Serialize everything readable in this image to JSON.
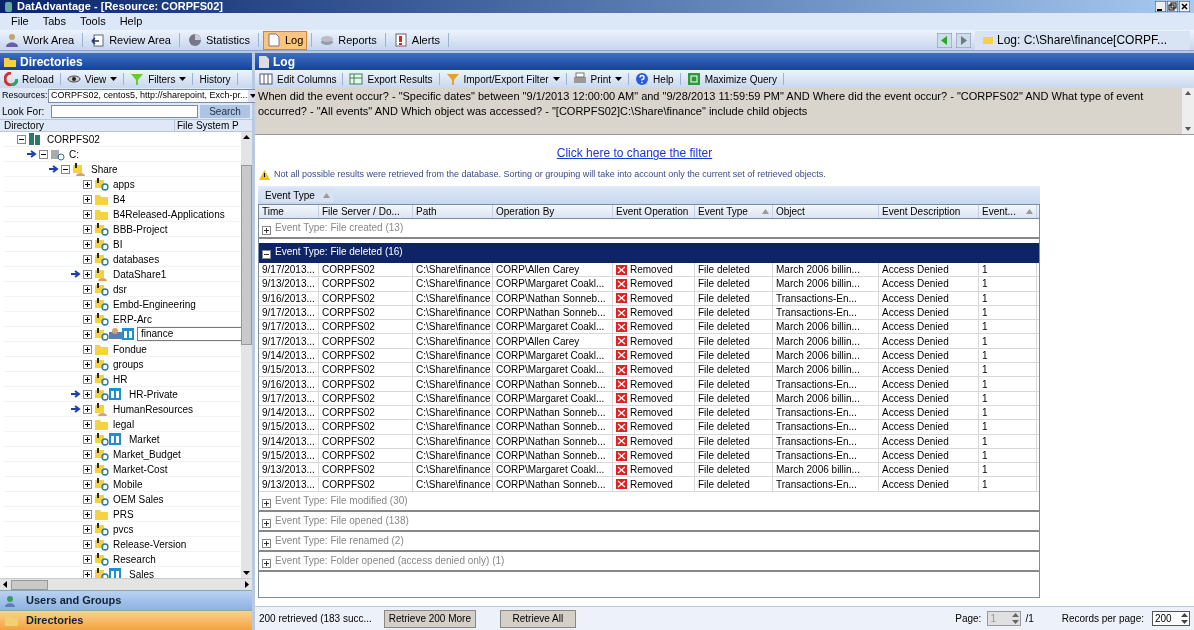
{
  "window": {
    "title": "DatAdvantage  - [Resource: CORPFS02]"
  },
  "menu": [
    "File",
    "Tabs",
    "Tools",
    "Help"
  ],
  "toolbar": [
    {
      "label": "Work Area",
      "selected": false
    },
    {
      "label": "Review Area",
      "selected": false
    },
    {
      "label": "Statistics",
      "selected": false
    },
    {
      "label": "Log",
      "selected": true
    },
    {
      "label": "Reports",
      "selected": false
    },
    {
      "label": "Alerts",
      "selected": false
    }
  ],
  "breadcrumb": "Log: C:\\Share\\finance[CORPF...",
  "left_panel": {
    "title": "Directories",
    "toolbar": [
      {
        "label": "Reload",
        "dropdown": false
      },
      {
        "label": "View",
        "dropdown": true
      },
      {
        "label": "Filters",
        "dropdown": true
      },
      {
        "label": "History",
        "dropdown": false
      }
    ],
    "resources_label": "Resources:",
    "resources_value": "CORPFS02, centos5, http://sharepoint, Exch-pr...",
    "look_for_label": "Look For:",
    "search_button": "Search",
    "columns": [
      "Directory",
      "File System P"
    ],
    "tree": [
      {
        "label": "CORPFS02",
        "kind": "server",
        "arrow": false,
        "tagged": false,
        "editing": false,
        "expanded": true,
        "children": [
          {
            "label": "C:",
            "kind": "drive",
            "arrow": true,
            "tagged": false,
            "editing": false,
            "expanded": true,
            "children": [
              {
                "label": "Share",
                "kind": "shared",
                "arrow": true,
                "tagged": false,
                "editing": false,
                "expanded": true,
                "children": [
                  {
                    "label": "apps",
                    "kind": "share",
                    "arrow": false,
                    "tagged": false,
                    "editing": false,
                    "expanded": false
                  },
                  {
                    "label": "B4",
                    "kind": "folder",
                    "arrow": false,
                    "tagged": false,
                    "editing": false,
                    "expanded": false
                  },
                  {
                    "label": "B4Released-Applications",
                    "kind": "folder",
                    "arrow": false,
                    "tagged": false,
                    "editing": false,
                    "expanded": false
                  },
                  {
                    "label": "BBB-Project",
                    "kind": "share",
                    "arrow": false,
                    "tagged": false,
                    "editing": false,
                    "expanded": false
                  },
                  {
                    "label": "BI",
                    "kind": "share",
                    "arrow": false,
                    "tagged": false,
                    "editing": false,
                    "expanded": false
                  },
                  {
                    "label": "databases",
                    "kind": "share",
                    "arrow": false,
                    "tagged": false,
                    "editing": false,
                    "expanded": false
                  },
                  {
                    "label": "DataShare1",
                    "kind": "shared",
                    "arrow": true,
                    "tagged": false,
                    "editing": false,
                    "expanded": false
                  },
                  {
                    "label": "dsr",
                    "kind": "share",
                    "arrow": false,
                    "tagged": false,
                    "editing": false,
                    "expanded": false
                  },
                  {
                    "label": "Embd-Engineering",
                    "kind": "share",
                    "arrow": false,
                    "tagged": false,
                    "editing": false,
                    "expanded": false
                  },
                  {
                    "label": "ERP-Arc",
                    "kind": "share",
                    "arrow": false,
                    "tagged": false,
                    "editing": false,
                    "expanded": false
                  },
                  {
                    "label": "finance",
                    "kind": "share",
                    "arrow": false,
                    "tagged": true,
                    "editing": true,
                    "expanded": false
                  },
                  {
                    "label": "Fondue",
                    "kind": "folder",
                    "arrow": false,
                    "tagged": false,
                    "editing": false,
                    "expanded": false
                  },
                  {
                    "label": "groups",
                    "kind": "share",
                    "arrow": false,
                    "tagged": false,
                    "editing": false,
                    "expanded": false
                  },
                  {
                    "label": "HR",
                    "kind": "share",
                    "arrow": false,
                    "tagged": false,
                    "editing": false,
                    "expanded": false
                  },
                  {
                    "label": "HR-Private",
                    "kind": "share",
                    "arrow": true,
                    "tagged": true,
                    "editing": false,
                    "expanded": false
                  },
                  {
                    "label": "HumanResources",
                    "kind": "shared",
                    "arrow": true,
                    "tagged": false,
                    "editing": false,
                    "expanded": false
                  },
                  {
                    "label": "legal",
                    "kind": "folder",
                    "arrow": false,
                    "tagged": false,
                    "editing": false,
                    "expanded": false
                  },
                  {
                    "label": "Market",
                    "kind": "share",
                    "arrow": false,
                    "tagged": true,
                    "editing": false,
                    "expanded": false
                  },
                  {
                    "label": "Market_Budget",
                    "kind": "share",
                    "arrow": false,
                    "tagged": false,
                    "editing": false,
                    "expanded": false
                  },
                  {
                    "label": "Market-Cost",
                    "kind": "share",
                    "arrow": false,
                    "tagged": false,
                    "editing": false,
                    "expanded": false
                  },
                  {
                    "label": "Mobile",
                    "kind": "share",
                    "arrow": false,
                    "tagged": false,
                    "editing": false,
                    "expanded": false
                  },
                  {
                    "label": "OEM Sales",
                    "kind": "share",
                    "arrow": false,
                    "tagged": false,
                    "editing": false,
                    "expanded": false
                  },
                  {
                    "label": "PRS",
                    "kind": "folder",
                    "arrow": false,
                    "tagged": false,
                    "editing": false,
                    "expanded": false
                  },
                  {
                    "label": "pvcs",
                    "kind": "share",
                    "arrow": false,
                    "tagged": false,
                    "editing": false,
                    "expanded": false
                  },
                  {
                    "label": "Release-Version",
                    "kind": "share",
                    "arrow": false,
                    "tagged": false,
                    "editing": false,
                    "expanded": false
                  },
                  {
                    "label": "Research",
                    "kind": "share",
                    "arrow": false,
                    "tagged": false,
                    "editing": false,
                    "expanded": false
                  },
                  {
                    "label": "Sales",
                    "kind": "share",
                    "arrow": false,
                    "tagged": true,
                    "editing": false,
                    "expanded": false
                  }
                ]
              }
            ]
          }
        ]
      }
    ],
    "nav": [
      {
        "label": "Users and Groups",
        "selected": false
      },
      {
        "label": "Directories",
        "selected": true
      }
    ]
  },
  "log_panel": {
    "title": "Log",
    "toolbar": [
      {
        "label": "Edit Columns",
        "dropdown": false
      },
      {
        "label": "Export Results",
        "dropdown": false
      },
      {
        "label": "Import/Export Filter",
        "dropdown": true
      },
      {
        "label": "Print",
        "dropdown": true
      },
      {
        "label": "Help",
        "dropdown": false
      },
      {
        "label": "Maximize Query",
        "dropdown": false
      }
    ],
    "filter_text": "When did the event occur? - \"Specific dates\" between \"9/1/2013 12:00:00 AM\" and \"9/28/2013 11:59:59 PM\" AND Where did the event occur? - \"CORPFS02\" AND What type of event occurred? - \"All events\" AND Which object was accessed? - \"[CORPFS02]C:\\Share\\finance\" include child objects",
    "change_filter_link": "Click here to change the filter",
    "warning": "Not all possible results were retrieved from the database. Sorting or grouping will take into account only the current set of retrieved objects.",
    "group_by": "Event Type",
    "columns": [
      {
        "label": "Time",
        "sorted": false
      },
      {
        "label": "File Server / Do...",
        "sorted": false
      },
      {
        "label": "Path",
        "sorted": false
      },
      {
        "label": "Operation By",
        "sorted": false
      },
      {
        "label": "Event Operation",
        "sorted": false
      },
      {
        "label": "Event Type",
        "sorted": true
      },
      {
        "label": "Object",
        "sorted": false
      },
      {
        "label": "Event Description",
        "sorted": false
      },
      {
        "label": "Event...",
        "sorted": true
      }
    ],
    "groups": [
      {
        "label": "Event Type:  File created (13)",
        "expanded": false
      },
      {
        "label": "Event Type:  File deleted (16)",
        "expanded": true,
        "rows": [
          [
            "9/17/2013...",
            "CORPFS02",
            "C:\\Share\\finance",
            "CORP\\Allen Carey",
            "Removed",
            "File deleted",
            "March  2006  billin...",
            "Access Denied",
            "1"
          ],
          [
            "9/13/2013...",
            "CORPFS02",
            "C:\\Share\\finance",
            "CORP\\Margaret  Coakl...",
            "Removed",
            "File deleted",
            "March  2006  billin...",
            "Access Denied",
            "1"
          ],
          [
            "9/16/2013...",
            "CORPFS02",
            "C:\\Share\\finance",
            "CORP\\Nathan  Sonneb...",
            "Removed",
            "File deleted",
            "Transactions-En...",
            "Access Denied",
            "1"
          ],
          [
            "9/17/2013...",
            "CORPFS02",
            "C:\\Share\\finance",
            "CORP\\Nathan  Sonneb...",
            "Removed",
            "File deleted",
            "Transactions-En...",
            "Access Denied",
            "1"
          ],
          [
            "9/17/2013...",
            "CORPFS02",
            "C:\\Share\\finance",
            "CORP\\Margaret  Coakl...",
            "Removed",
            "File deleted",
            "March  2006  billin...",
            "Access Denied",
            "1"
          ],
          [
            "9/17/2013...",
            "CORPFS02",
            "C:\\Share\\finance",
            "CORP\\Allen Carey",
            "Removed",
            "File deleted",
            "March  2006  billin...",
            "Access Denied",
            "1"
          ],
          [
            "9/14/2013...",
            "CORPFS02",
            "C:\\Share\\finance",
            "CORP\\Margaret  Coakl...",
            "Removed",
            "File deleted",
            "March  2006  billin...",
            "Access Denied",
            "1"
          ],
          [
            "9/15/2013...",
            "CORPFS02",
            "C:\\Share\\finance",
            "CORP\\Margaret  Coakl...",
            "Removed",
            "File deleted",
            "March  2006  billin...",
            "Access Denied",
            "1"
          ],
          [
            "9/16/2013...",
            "CORPFS02",
            "C:\\Share\\finance",
            "CORP\\Nathan  Sonneb...",
            "Removed",
            "File deleted",
            "Transactions-En...",
            "Access Denied",
            "1"
          ],
          [
            "9/17/2013...",
            "CORPFS02",
            "C:\\Share\\finance",
            "CORP\\Margaret  Coakl...",
            "Removed",
            "File deleted",
            "March  2006  billin...",
            "Access Denied",
            "1"
          ],
          [
            "9/14/2013...",
            "CORPFS02",
            "C:\\Share\\finance",
            "CORP\\Nathan  Sonneb...",
            "Removed",
            "File deleted",
            "Transactions-En...",
            "Access Denied",
            "1"
          ],
          [
            "9/15/2013...",
            "CORPFS02",
            "C:\\Share\\finance",
            "CORP\\Nathan  Sonneb...",
            "Removed",
            "File deleted",
            "Transactions-En...",
            "Access Denied",
            "1"
          ],
          [
            "9/14/2013...",
            "CORPFS02",
            "C:\\Share\\finance",
            "CORP\\Nathan  Sonneb...",
            "Removed",
            "File deleted",
            "Transactions-En...",
            "Access Denied",
            "1"
          ],
          [
            "9/15/2013...",
            "CORPFS02",
            "C:\\Share\\finance",
            "CORP\\Nathan  Sonneb...",
            "Removed",
            "File deleted",
            "Transactions-En...",
            "Access Denied",
            "1"
          ],
          [
            "9/13/2013...",
            "CORPFS02",
            "C:\\Share\\finance",
            "CORP\\Margaret  Coakl...",
            "Removed",
            "File deleted",
            "March  2006  billin...",
            "Access Denied",
            "1"
          ],
          [
            "9/13/2013...",
            "CORPFS02",
            "C:\\Share\\finance",
            "CORP\\Nathan  Sonneb...",
            "Removed",
            "File deleted",
            "Transactions-En...",
            "Access Denied",
            "1"
          ]
        ]
      },
      {
        "label": "Event Type:  File modified (30)",
        "expanded": false
      },
      {
        "label": "Event Type:  File opened (138)",
        "expanded": false
      },
      {
        "label": "Event Type:  File renamed (2)",
        "expanded": false
      },
      {
        "label": "Event Type:  Folder opened (access denied only) (1)",
        "expanded": false
      }
    ],
    "status": {
      "retrieved": "200  retrieved  (183 succ...",
      "retrieve_more": "Retrieve 200 More",
      "retrieve_all": "Retrieve All",
      "page_label": "Page:",
      "page_value": "1",
      "page_total": "/1",
      "records_label": "Records per page:",
      "records_value": "200"
    }
  }
}
